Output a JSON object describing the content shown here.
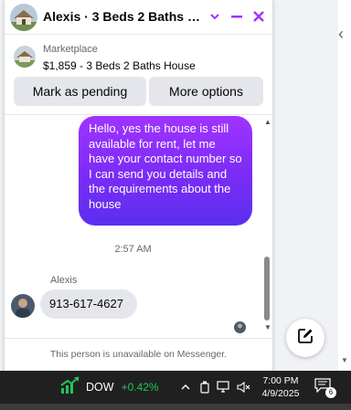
{
  "header": {
    "title": "Alexis · 3 Beds 2 Baths Ho...",
    "accent_color": "#a033ff"
  },
  "listing": {
    "label": "Marketplace",
    "title": "$1,859 - 3 Beds 2 Baths House",
    "primary_action": "Mark as pending",
    "secondary_action": "More options"
  },
  "messages": {
    "outgoing": "Hello, yes the house is still available for rent, let me have your contact number so I can send you details and the requirements about the house",
    "timestamp": "2:57 AM",
    "sender_name": "Alexis",
    "incoming": "913-617-4627"
  },
  "footer": {
    "notice": "This person is unavailable on Messenger."
  },
  "taskbar": {
    "stock_name": "DOW",
    "stock_change": "+0.42%",
    "time": "7:00 PM",
    "date": "4/9/2025",
    "notification_count": "6"
  },
  "icons": {
    "header": [
      "house-avatar",
      "chevron-down-icon",
      "minimize-icon",
      "close-icon"
    ],
    "compose": "compose-icon",
    "tray": [
      "chevron-up-icon",
      "device-icon",
      "network-icon",
      "speaker-muted-icon",
      "notification-icon"
    ]
  }
}
